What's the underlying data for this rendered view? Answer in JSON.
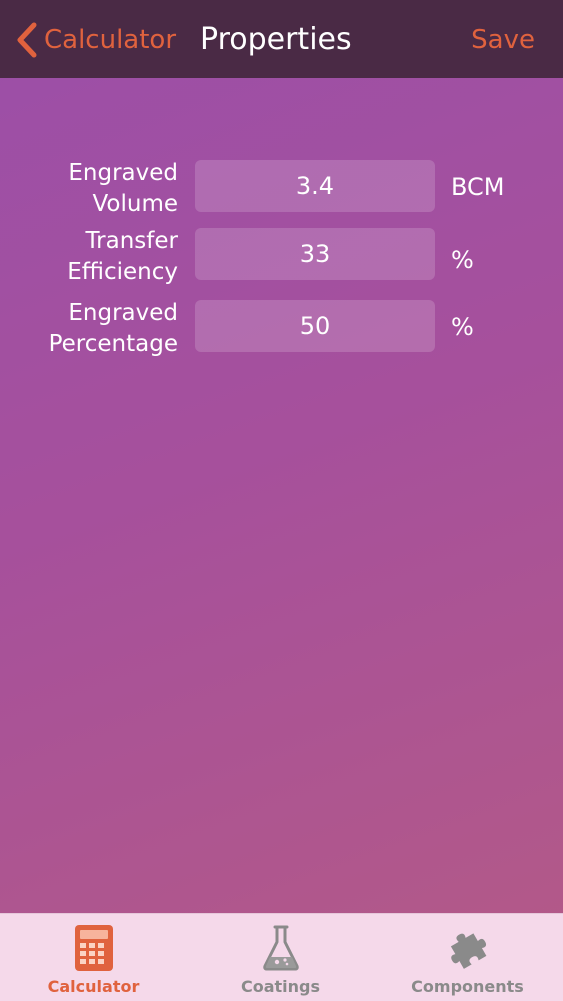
{
  "navbar": {
    "back_label": "Calculator",
    "title": "Properties",
    "save_label": "Save"
  },
  "form": {
    "rows": [
      {
        "label_line1": "Engraved",
        "label_line2": "Volume",
        "value": "3.4",
        "unit": "BCM"
      },
      {
        "label_line1": "Transfer",
        "label_line2": "Efficiency",
        "value": "33",
        "unit": "%"
      },
      {
        "label_line1": "Engraved",
        "label_line2": "Percentage",
        "value": "50",
        "unit": "%"
      }
    ]
  },
  "tabbar": {
    "tabs": [
      {
        "label": "Calculator",
        "icon": "calculator-icon",
        "active": true
      },
      {
        "label": "Coatings",
        "icon": "flask-icon",
        "active": false
      },
      {
        "label": "Components",
        "icon": "puzzle-piece-icon",
        "active": false
      }
    ]
  },
  "colors": {
    "accent": "#e0623e",
    "navbar_bg": "#4a2a45",
    "tabbar_bg": "#f5d9ea",
    "inactive_tab": "#8a8a8a"
  }
}
